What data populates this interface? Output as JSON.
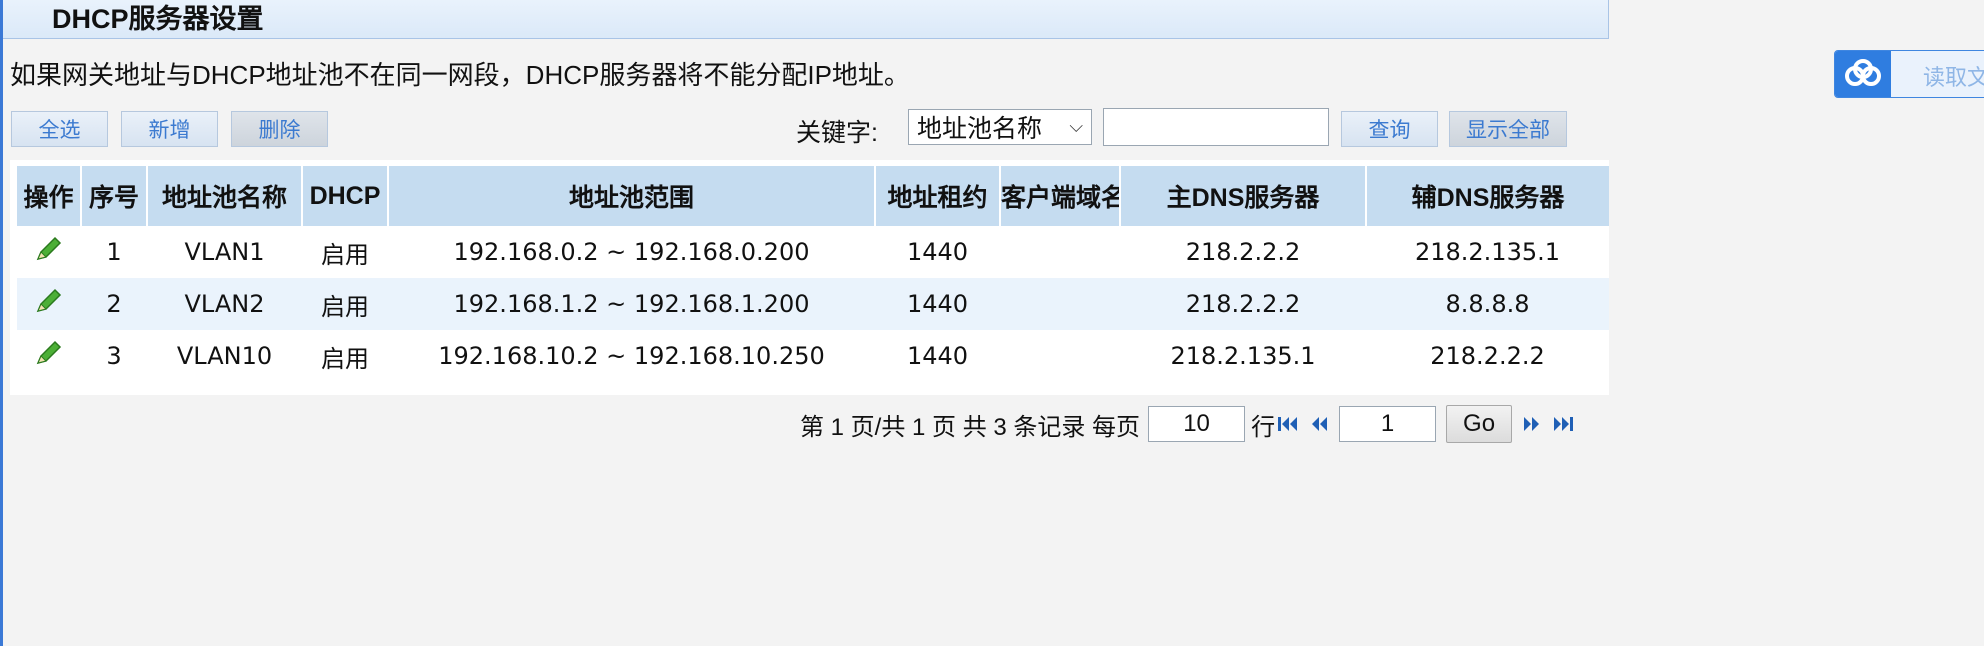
{
  "title": "DHCP服务器设置",
  "notice": "如果网关地址与DHCP地址池不在同一网段，DHCP服务器将不能分配IP地址。",
  "toolbar": {
    "select_all": "全选",
    "add": "新增",
    "delete": "删除"
  },
  "search": {
    "label": "关键字:",
    "field_selected": "地址池名称",
    "keyword_value": "",
    "query": "查询",
    "show_all": "显示全部"
  },
  "table": {
    "headers": [
      "操作",
      "序号",
      "地址池名称",
      "DHCP",
      "地址池范围",
      "地址租约",
      "客户端域名",
      "主DNS服务器",
      "辅DNS服务器"
    ],
    "rows": [
      {
        "index": "1",
        "name": "VLAN1",
        "dhcp": "启用",
        "range": "192.168.0.2 ~ 192.168.0.200",
        "lease": "1440",
        "domain": "",
        "dns1": "218.2.2.2",
        "dns2": "218.2.135.1"
      },
      {
        "index": "2",
        "name": "VLAN2",
        "dhcp": "启用",
        "range": "192.168.1.2 ~ 192.168.1.200",
        "lease": "1440",
        "domain": "",
        "dns1": "218.2.2.2",
        "dns2": "8.8.8.8"
      },
      {
        "index": "3",
        "name": "VLAN10",
        "dhcp": "启用",
        "range": "192.168.10.2 ~ 192.168.10.250",
        "lease": "1440",
        "domain": "",
        "dns1": "218.2.135.1",
        "dns2": "218.2.2.2"
      }
    ]
  },
  "pager": {
    "summary": "第 1 页/共 1 页 共 3 条记录 每页",
    "per_page": "10",
    "row_unit": "行",
    "page_input": "1",
    "go": "Go"
  },
  "widget": {
    "label": "读取文",
    "icon": "cloud-icon"
  },
  "colors": {
    "header_bg": "#c5dcf0",
    "link_blue": "#3b7ad0",
    "edit_icon": "#3a9a2a",
    "accent": "#2f7de0"
  }
}
